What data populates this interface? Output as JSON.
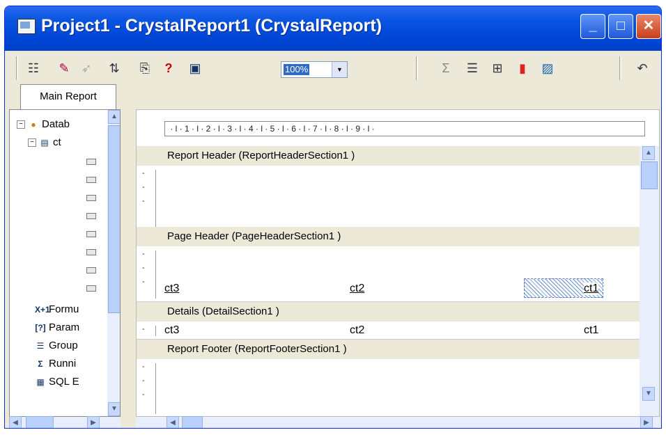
{
  "window": {
    "title": "Project1 - CrystalReport1 (CrystalReport)",
    "icons": [
      "app-icon",
      "minimize-icon",
      "maximize-icon",
      "close-icon"
    ]
  },
  "toolbar": {
    "zoom": "100%",
    "icons": [
      "toggle-tree-icon",
      "field-explorer-icon",
      "insert-icon",
      "sort-icon",
      "format-icon",
      "help-icon",
      "field-object-icon",
      "summary-icon",
      "group-icon",
      "subreport-icon",
      "chart-icon",
      "picture-icon",
      "undo-icon"
    ]
  },
  "tab": {
    "label": "Main Report"
  },
  "tree": {
    "database": "Datab",
    "table": "ct",
    "fields_count": 8,
    "formula": "Formu",
    "parameter": "Param",
    "group": "Group",
    "running": "Runni",
    "sql": "SQL E"
  },
  "ruler": {
    "text": " · l · 1 · l · 2 · l · 3 · l · 4 · l · 5 · l · 6 · l · 7 · l · 8 · l · 9 · l ·"
  },
  "sections": {
    "report_header": "Report Header  (ReportHeaderSection1 )",
    "page_header": "Page Header  (PageHeaderSection1 )",
    "details": "Details  (DetailSection1 )",
    "report_footer": "Report Footer  (ReportFooterSection1 )"
  },
  "page_header_fields": {
    "f1": "ct3",
    "f2": "ct2",
    "f3": "ct1"
  },
  "detail_fields": {
    "f1": "ct3",
    "f2": "ct2",
    "f3": "ct1"
  }
}
